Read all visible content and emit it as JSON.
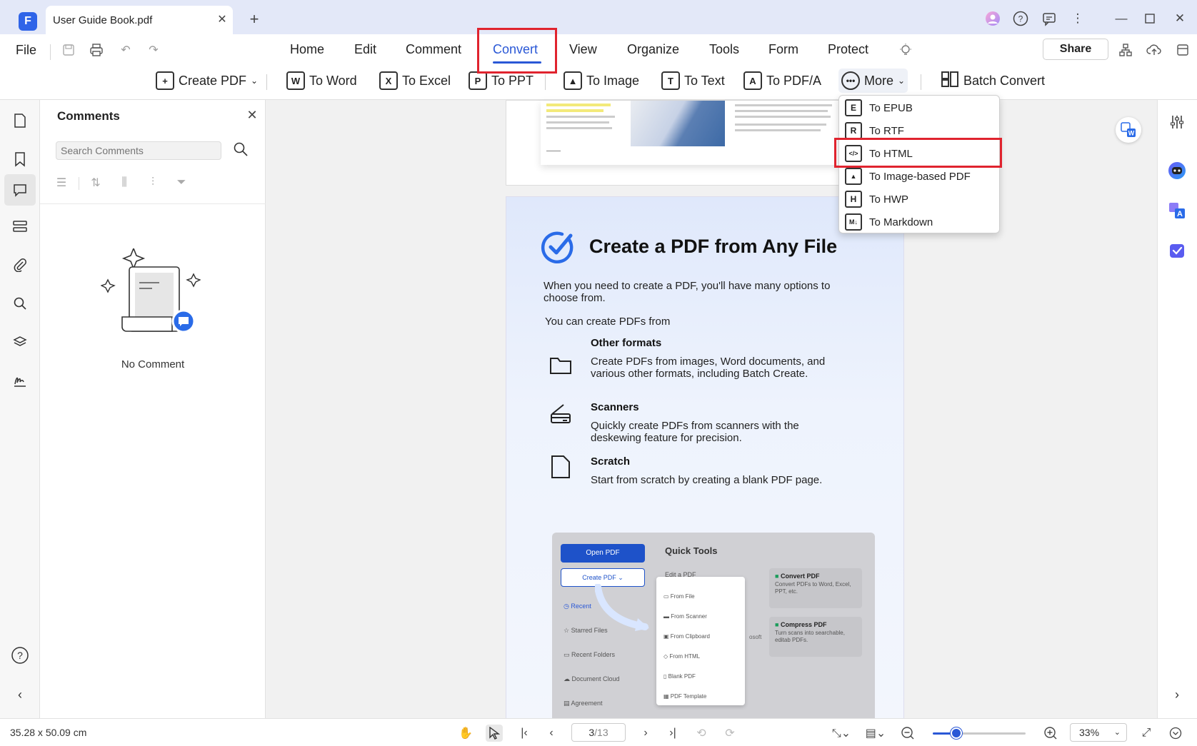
{
  "window": {
    "tab_title": "User Guide Book.pdf",
    "share_label": "Share"
  },
  "toolbar": {
    "file_label": "File",
    "main_tabs": [
      "Home",
      "Edit",
      "Comment",
      "Convert",
      "View",
      "Organize",
      "Tools",
      "Form",
      "Protect"
    ],
    "active_tab": "Convert",
    "accent_color": "#2a58d6",
    "highlight_color": "#e0232e"
  },
  "convert_tools": {
    "create_pdf": "Create PDF",
    "to_word": "To Word",
    "to_excel": "To Excel",
    "to_ppt": "To PPT",
    "to_image": "To Image",
    "to_text": "To Text",
    "to_pdfa": "To PDF/A",
    "more": "More",
    "batch_convert": "Batch Convert"
  },
  "more_menu": {
    "items": [
      {
        "label": "To EPUB",
        "glyph": "E"
      },
      {
        "label": "To RTF",
        "glyph": "R"
      },
      {
        "label": "To HTML",
        "glyph": "</>"
      },
      {
        "label": "To Image-based PDF",
        "glyph": "▲"
      },
      {
        "label": "To HWP",
        "glyph": "H"
      },
      {
        "label": "To Markdown",
        "glyph": "M↓"
      }
    ],
    "highlighted": "To HTML"
  },
  "comments_panel": {
    "title": "Comments",
    "search_placeholder": "Search Comments",
    "empty_text": "No Comment"
  },
  "document": {
    "heading": "Create a PDF from Any File",
    "intro": "When you need to create a PDF, you'll have many options to choose from.",
    "lead": "You can create PDFs from",
    "features": [
      {
        "title": "Other formats",
        "desc": "Create PDFs from images, Word documents, and various other formats, including Batch Create."
      },
      {
        "title": "Scanners",
        "desc": "Quickly create PDFs from scanners with the deskewing feature for precision."
      },
      {
        "title": "Scratch",
        "desc": "Start from scratch by creating a blank PDF page."
      }
    ],
    "embedded": {
      "open_pdf": "Open PDF",
      "create_pdf": "Create PDF",
      "quick_tools": "Quick Tools",
      "sidebar": [
        "Recent",
        "Starred Files",
        "Recent Folders",
        "Document Cloud",
        "Agreement"
      ],
      "menu": [
        "From File",
        "From Scanner",
        "From Clipboard",
        "From HTML",
        "Blank PDF",
        "PDF Template"
      ],
      "edit_pdf": "Edit a PDF",
      "convert_pdf": "Convert PDF",
      "convert_desc": "Convert PDFs to Word, Excel, PPT, etc.",
      "compress_pdf": "Compress PDF",
      "compress_desc": "Turn scans into searchable, editab PDFs.",
      "microsoft_fragment": "osoft"
    }
  },
  "statusbar": {
    "page_size": "35.28 x 50.09 cm",
    "page_current": "3",
    "page_total": "/13",
    "zoom": "33%",
    "zoom_fraction": 0.33
  }
}
